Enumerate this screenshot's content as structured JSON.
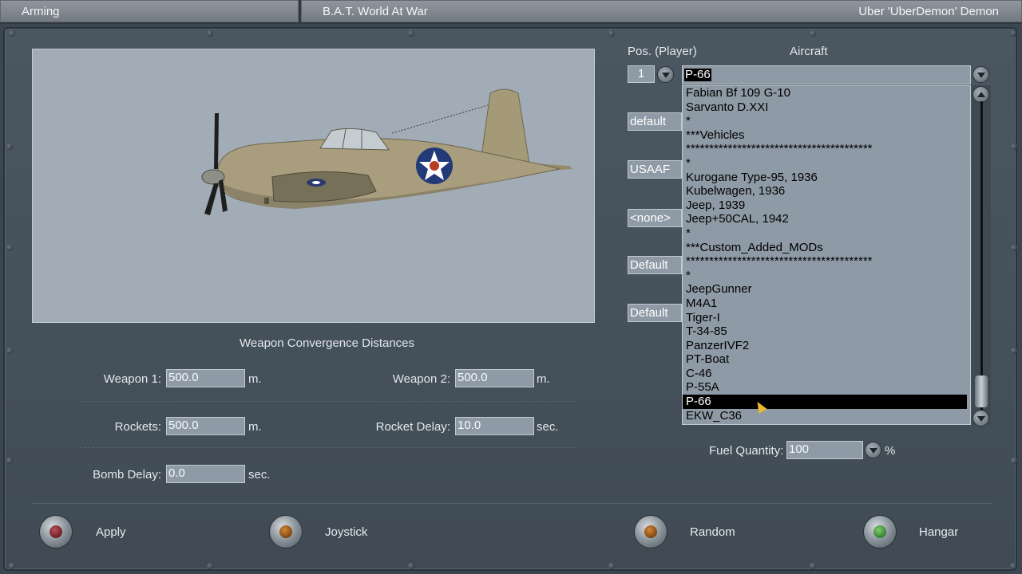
{
  "topbar": {
    "section": "Arming",
    "app_title": "B.A.T. World At War",
    "user": "Uber 'UberDemon' Demon"
  },
  "convergence": {
    "heading": "Weapon Convergence Distances",
    "weapon1_label": "Weapon 1:",
    "weapon1_value": "500.0",
    "weapon1_unit": "m.",
    "weapon2_label": "Weapon 2:",
    "weapon2_value": "500.0",
    "weapon2_unit": "m.",
    "rockets_label": "Rockets:",
    "rockets_value": "500.0",
    "rockets_unit": "m.",
    "rocket_delay_label": "Rocket Delay:",
    "rocket_delay_value": "10.0",
    "rocket_delay_unit": "sec.",
    "bomb_delay_label": "Bomb Delay:",
    "bomb_delay_value": "0.0",
    "bomb_delay_unit": "sec."
  },
  "aircraft": {
    "pos_label": "Pos. (Player)",
    "aircraft_label": "Aircraft",
    "position_value": "1",
    "selected": "P-66",
    "side_values": [
      "default",
      "USAAF",
      "<none>",
      "Default",
      "Default"
    ],
    "list": [
      "Fabian Bf 109 G-10",
      "Sarvanto D.XXI",
      "*",
      "***Vehicles",
      "****************************************",
      "*",
      "Kurogane Type-95, 1936",
      "Kubelwagen, 1936",
      "Jeep, 1939",
      "Jeep+50CAL, 1942",
      "*",
      "***Custom_Added_MODs",
      "****************************************",
      "*",
      "JeepGunner",
      "M4A1",
      "Tiger-I",
      "T-34-85",
      "PanzerIVF2",
      "PT-Boat",
      "C-46",
      "P-55A",
      "P-66",
      "EKW_C36"
    ],
    "selected_index": 22
  },
  "fuel": {
    "label": "Fuel Quantity:",
    "value": "100",
    "unit": "%"
  },
  "buttons": {
    "apply": "Apply",
    "joystick": "Joystick",
    "random": "Random",
    "hangar": "Hangar"
  },
  "colors": {
    "panel": "#44505a",
    "field": "#8e9aa5",
    "preview_bg": "#a2acb6"
  }
}
